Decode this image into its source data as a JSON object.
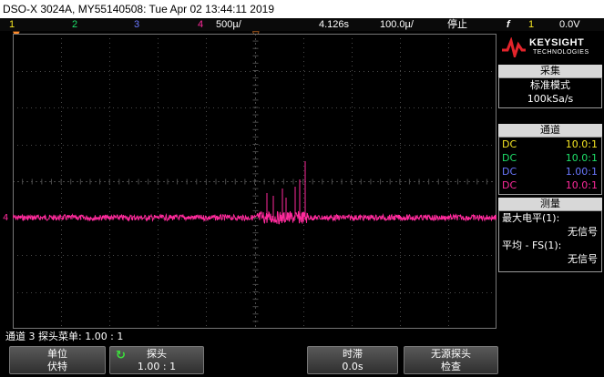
{
  "title": "DSO-X 3024A, MY55140508: Tue Apr 02 13:44:11 2019",
  "status": {
    "ch1": "1",
    "ch2": "2",
    "ch3": "3",
    "ch4": "4",
    "timebase": "500µ/",
    "delay": "4.126s",
    "sample_rate": "100.0µ/",
    "run_state": "停止",
    "trigger_symbol": "f",
    "trigger_channel": "1",
    "trigger_level": "0.0V"
  },
  "colors": {
    "ch1": "#f5e623",
    "ch2": "#1ee06a",
    "ch3": "#6b78ff",
    "ch4": "#ff2a9c",
    "grid": "#4a4a4a"
  },
  "logo": {
    "name": "KEYSIGHT",
    "sub": "TECHNOLOGIES"
  },
  "acquisition": {
    "header": "采集",
    "mode": "标准模式",
    "rate": "100kSa/s"
  },
  "channels": {
    "header": "通道",
    "items": [
      {
        "coupling": "DC",
        "scale": "10.0:1"
      },
      {
        "coupling": "DC",
        "scale": "10.0:1"
      },
      {
        "coupling": "DC",
        "scale": "1.00:1"
      },
      {
        "coupling": "DC",
        "scale": "10.0:1"
      }
    ]
  },
  "measure": {
    "header": "测量",
    "items": [
      {
        "label": "最大电平(1):",
        "value": "无信号"
      },
      {
        "label": "平均 - FS(1):",
        "value": "无信号"
      }
    ]
  },
  "bottom_status": "通道 3 探头菜单: 1.00 : 1",
  "softkeys": [
    {
      "top": "单位",
      "bottom": "伏特"
    },
    {
      "top": "探头",
      "bottom": "1.00 : 1"
    },
    {
      "top": "时滞",
      "bottom": "0.0s"
    },
    {
      "top": "无源探头",
      "bottom": "检查"
    }
  ],
  "ground_marker": "4"
}
